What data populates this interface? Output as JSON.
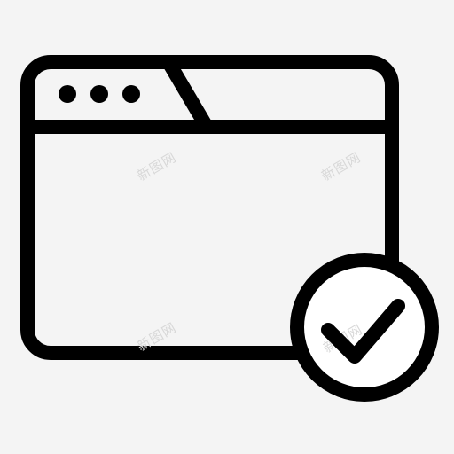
{
  "icon": {
    "name": "browser-window-check-icon",
    "stroke_color": "#000000",
    "fill_color": "#ffffff",
    "background_color": "#f4f4f4",
    "window_dots": 3
  },
  "watermark": {
    "text": "新图网",
    "color": "#d8d8d8"
  }
}
